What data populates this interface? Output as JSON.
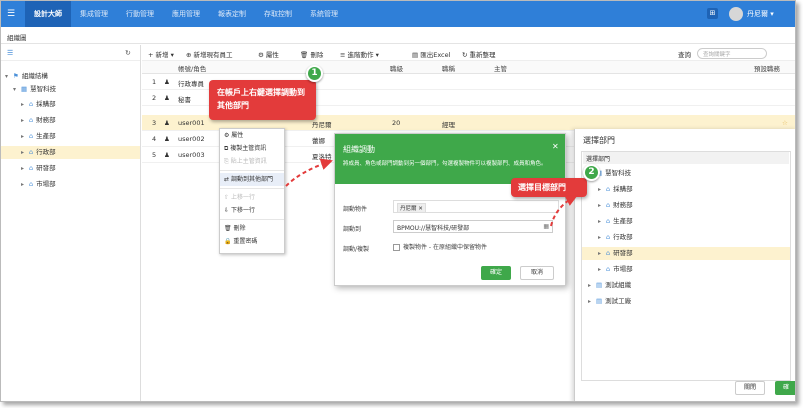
{
  "header": {
    "app_title": "設計大師",
    "nav": [
      "集成管理",
      "行動管理",
      "應用管理",
      "報表定制",
      "存取控制",
      "系統管理"
    ],
    "grid_icon": "⊞",
    "user_name": "丹尼爾 ▾"
  },
  "breadcrumb": "組織圖",
  "left": {
    "tree": [
      {
        "label": "組織結構",
        "icon": "org-icon"
      },
      {
        "label": "慧智科技",
        "icon": "company-icon"
      },
      {
        "label": "採購部",
        "icon": "dept-icon"
      },
      {
        "label": "財務部",
        "icon": "dept-icon"
      },
      {
        "label": "生產部",
        "icon": "dept-icon"
      },
      {
        "label": "行政部",
        "icon": "dept-icon"
      },
      {
        "label": "研發部",
        "icon": "dept-icon"
      },
      {
        "label": "市場部",
        "icon": "dept-icon"
      }
    ]
  },
  "toolbar": {
    "add": "+ 新增 ▾",
    "add_existing": "新增現有員工",
    "properties": "屬性",
    "delete": "刪除",
    "advanced": "進階動作 ▾",
    "export": "匯出Excel",
    "reorg": "重新整理",
    "search_label": "查詢",
    "search_placeholder": "查詢關鍵字"
  },
  "table": {
    "headers": [
      "帳號/角色",
      "職級",
      "職稱",
      "主管",
      "預設職務"
    ],
    "rows": [
      {
        "no": "1",
        "account": "行政專員",
        "name": "",
        "level": "",
        "title": "",
        "manager": ""
      },
      {
        "no": "2",
        "account": "秘書",
        "name": "",
        "level": "",
        "title": "",
        "manager": ""
      },
      {
        "no": "3",
        "account": "user001",
        "name": "丹尼爾",
        "level": "20",
        "title": "經理",
        "manager": ""
      },
      {
        "no": "4",
        "account": "user002",
        "name": "蕾娜",
        "level": "",
        "title": "",
        "manager": ""
      },
      {
        "no": "5",
        "account": "user003",
        "name": "夏洛特",
        "level": "",
        "title": "",
        "manager": ""
      }
    ]
  },
  "context_menu": {
    "items": [
      "屬性",
      "複製主管資訊",
      "貼上主管資訊",
      "調動到其他部門",
      "上移一行",
      "下移一行",
      "刪除",
      "重置密碼"
    ]
  },
  "callouts": {
    "c1_num": "1",
    "c1_text": "在帳戶上右鍵選擇調動到其他部門",
    "c2_num": "2",
    "c2_text": "選擇目標部門"
  },
  "dialog": {
    "title": "組織調動",
    "desc": "將成員、角色或部門調動到另一個部門，勾選複製物件可以複製部門、成員和角色。",
    "label_object": "調動物件",
    "object_tag": "丹尼爾",
    "label_to": "調動到",
    "to_value": "BPMOU://慧智科技/研發部",
    "label_mode": "調動/複製",
    "copy_checkbox": "複製物件 - 在原組織中保留物件",
    "ok": "確定",
    "cancel": "取消"
  },
  "right_panel": {
    "title": "選擇部門",
    "subheader": "選擇部門",
    "tree": [
      {
        "label": "慧智科技",
        "icon": "company-icon"
      },
      {
        "label": "採購部",
        "icon": "dept-icon"
      },
      {
        "label": "財務部",
        "icon": "dept-icon"
      },
      {
        "label": "生產部",
        "icon": "dept-icon"
      },
      {
        "label": "行政部",
        "icon": "dept-icon"
      },
      {
        "label": "研發部",
        "icon": "dept-icon"
      },
      {
        "label": "市場部",
        "icon": "dept-icon"
      },
      {
        "label": "測試組織",
        "icon": "org-icon"
      },
      {
        "label": "測試工廠",
        "icon": "org-icon"
      }
    ],
    "close": "關閉",
    "ok": "確"
  },
  "colors": {
    "brand_blue": "#2f7fd8",
    "green": "#3fa84a",
    "callout_red": "#e33b3b",
    "highlight": "#fdf2cf"
  }
}
